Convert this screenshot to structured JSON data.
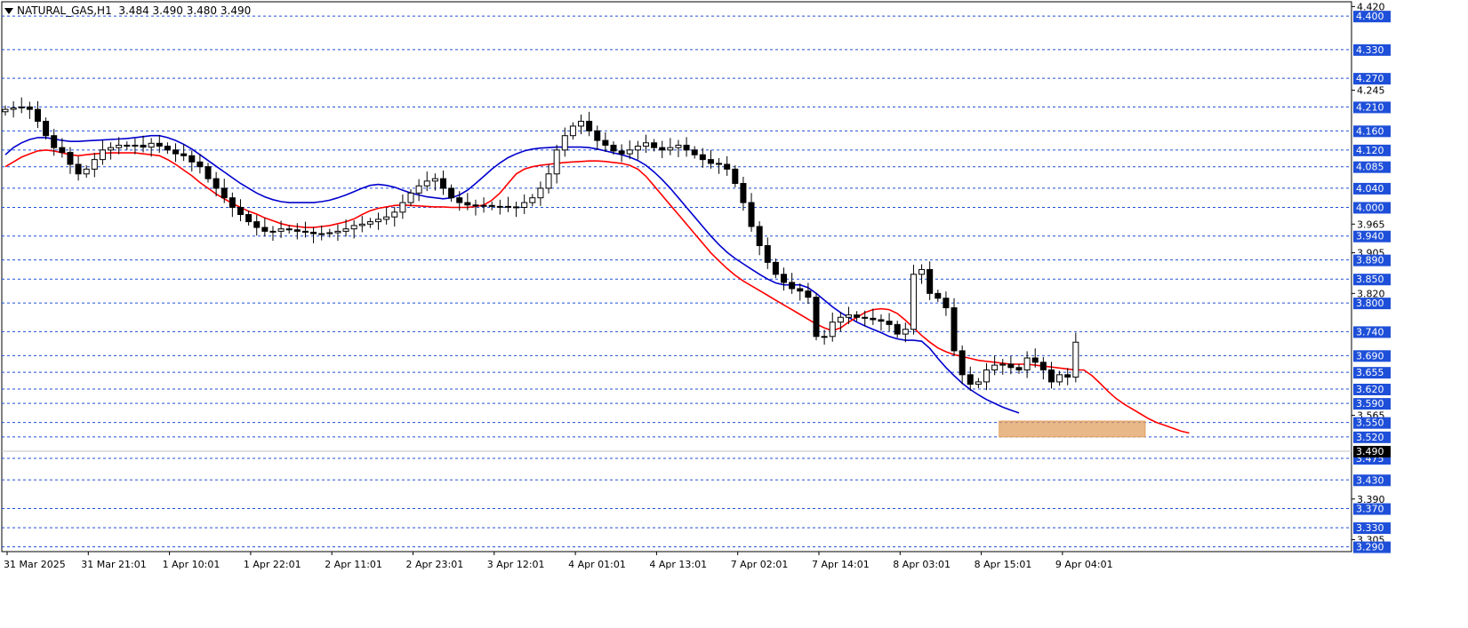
{
  "header": {
    "symbol": "NATURAL_GAS,H1",
    "ohlc": "3.484 3.490 3.480 3.490"
  },
  "colors": {
    "ema_fast": "#ff0000",
    "ema_slow": "#0000cd",
    "level_line": "#1e4fd8",
    "level_label_bg": "#1e4fd8",
    "current_price_bg": "#000000",
    "zone": "#e0a060",
    "candle_up": "#ffffff",
    "candle_down": "#000000"
  },
  "chart_data": {
    "type": "candlestick",
    "ylim": [
      3.28,
      4.43
    ],
    "x_labels": [
      "31 Mar 2025",
      "31 Mar 21:01",
      "1 Apr 10:01",
      "1 Apr 22:01",
      "2 Apr 11:01",
      "2 Apr 23:01",
      "3 Apr 12:01",
      "4 Apr 01:01",
      "4 Apr 13:01",
      "7 Apr 02:01",
      "7 Apr 14:01",
      "8 Apr 03:01",
      "8 Apr 15:01",
      "9 Apr 04:01"
    ],
    "y_ticks_plain": [
      4.42,
      4.245,
      3.965,
      3.905,
      3.82,
      3.565,
      3.39,
      3.305
    ],
    "levels": [
      4.4,
      4.33,
      4.27,
      4.21,
      4.16,
      4.12,
      4.085,
      4.04,
      4.0,
      3.94,
      3.89,
      3.85,
      3.8,
      3.74,
      3.69,
      3.655,
      3.62,
      3.59,
      3.55,
      3.52,
      3.475,
      3.43,
      3.37,
      3.33,
      3.29
    ],
    "current_price": 3.49,
    "zone": {
      "from": 3.52,
      "to": 3.553,
      "start_bar": 123,
      "end_bar": 141
    },
    "candle_count": 133,
    "close": [
      4.205,
      4.208,
      4.21,
      4.205,
      4.18,
      4.15,
      4.125,
      4.115,
      4.09,
      4.07,
      4.08,
      4.1,
      4.12,
      4.125,
      4.13,
      4.128,
      4.13,
      4.126,
      4.134,
      4.128,
      4.12,
      4.112,
      4.108,
      4.095,
      4.085,
      4.06,
      4.04,
      4.02,
      4.0,
      3.985,
      3.97,
      3.958,
      3.95,
      3.95,
      3.955,
      3.953,
      3.95,
      3.948,
      3.945,
      3.945,
      3.947,
      3.95,
      3.955,
      3.962,
      3.965,
      3.97,
      3.975,
      3.98,
      3.99,
      4.01,
      4.03,
      4.045,
      4.055,
      4.06,
      4.04,
      4.02,
      4.01,
      4.005,
      4.003,
      4.004,
      4.002,
      4.002,
      4.001,
      4.0,
      4.01,
      4.02,
      4.04,
      4.07,
      4.12,
      4.15,
      4.17,
      4.18,
      4.16,
      4.14,
      4.13,
      4.118,
      4.112,
      4.12,
      4.128,
      4.135,
      4.125,
      4.12,
      4.125,
      4.13,
      4.12,
      4.11,
      4.1,
      4.092,
      4.09,
      4.08,
      4.05,
      4.01,
      3.96,
      3.92,
      3.885,
      3.86,
      3.843,
      3.83,
      3.825,
      3.812,
      3.73,
      3.73,
      3.76,
      3.77,
      3.775,
      3.77,
      3.768,
      3.765,
      3.762,
      3.755,
      3.735,
      3.745,
      3.86,
      3.87,
      3.82,
      3.81,
      3.79,
      3.7,
      3.65,
      3.63,
      3.635,
      3.66,
      3.67,
      3.672,
      3.665,
      3.66,
      3.685,
      3.676,
      3.66,
      3.635,
      3.65,
      3.645,
      3.718
    ],
    "ema_red": [
      4.085,
      4.095,
      4.105,
      4.112,
      4.118,
      4.12,
      4.118,
      4.114,
      4.11,
      4.108,
      4.11,
      4.112,
      4.113,
      4.114,
      4.114,
      4.114,
      4.114,
      4.112,
      4.11,
      4.108,
      4.1,
      4.09,
      4.078,
      4.066,
      4.052,
      4.04,
      4.028,
      4.018,
      4.008,
      4.0,
      3.992,
      3.986,
      3.978,
      3.972,
      3.966,
      3.962,
      3.96,
      3.958,
      3.958,
      3.96,
      3.962,
      3.966,
      3.97,
      3.976,
      3.985,
      3.993,
      3.998,
      4.001,
      4.004,
      4.005,
      4.004,
      4.003,
      4.002,
      4.001,
      4.001,
      4.0,
      4.0,
      4.0,
      4.002,
      4.005,
      4.015,
      4.03,
      4.05,
      4.07,
      4.08,
      4.085,
      4.088,
      4.09,
      4.092,
      4.094,
      4.095,
      4.096,
      4.097,
      4.097,
      4.096,
      4.094,
      4.092,
      4.088,
      4.08,
      4.065,
      4.045,
      4.025,
      4.005,
      3.985,
      3.965,
      3.945,
      3.925,
      3.905,
      3.888,
      3.872,
      3.858,
      3.846,
      3.836,
      3.826,
      3.816,
      3.806,
      3.796,
      3.786,
      3.776,
      3.766,
      3.756,
      3.748,
      3.742,
      3.748,
      3.76,
      3.77,
      3.78,
      3.786,
      3.788,
      3.786,
      3.778,
      3.764,
      3.748,
      3.732,
      3.718,
      3.706,
      3.698,
      3.692,
      3.688,
      3.684,
      3.68,
      3.678,
      3.676,
      3.674,
      3.672,
      3.672,
      3.672,
      3.67,
      3.668,
      3.666,
      3.664,
      3.662,
      3.66
    ]
  },
  "overlay": {
    "ema_red_tail": [
      3.66,
      3.648,
      3.632,
      3.615,
      3.6,
      3.588,
      3.578,
      3.568,
      3.558,
      3.55,
      3.544,
      3.538,
      3.532,
      3.528
    ],
    "ema_blue": [
      4.11,
      4.125,
      4.135,
      4.142,
      4.146,
      4.146,
      4.143,
      4.14,
      4.138,
      4.138,
      4.139,
      4.14,
      4.141,
      4.142,
      4.143,
      4.144,
      4.146,
      4.148,
      4.15,
      4.15,
      4.146,
      4.14,
      4.132,
      4.122,
      4.11,
      4.098,
      4.086,
      4.074,
      4.062,
      4.05,
      4.04,
      4.03,
      4.022,
      4.016,
      4.012,
      4.01,
      4.01,
      4.01,
      4.01,
      4.012,
      4.015,
      4.02,
      4.026,
      4.033,
      4.04,
      4.046,
      4.048,
      4.046,
      4.042,
      4.036,
      4.03,
      4.026,
      4.022,
      4.02,
      4.018,
      4.02,
      4.026,
      4.036,
      4.05,
      4.065,
      4.08,
      4.093,
      4.104,
      4.112,
      4.118,
      4.122,
      4.124,
      4.125,
      4.126,
      4.126,
      4.126,
      4.126,
      4.125,
      4.122,
      4.118,
      4.114,
      4.11,
      4.105,
      4.098,
      4.088,
      4.074,
      4.058,
      4.04,
      4.02,
      4.0,
      3.98,
      3.96,
      3.94,
      3.922,
      3.906,
      3.893,
      3.882,
      3.871,
      3.86,
      3.85,
      3.842,
      3.838,
      3.838,
      3.838,
      3.832,
      3.82,
      3.806,
      3.792,
      3.78,
      3.77,
      3.76,
      3.752,
      3.745,
      3.738,
      3.73,
      3.725,
      3.722,
      3.722,
      3.72,
      3.705,
      3.684,
      3.665,
      3.648,
      3.632,
      3.619,
      3.608,
      3.598,
      3.59,
      3.582,
      3.576,
      3.57
    ]
  }
}
